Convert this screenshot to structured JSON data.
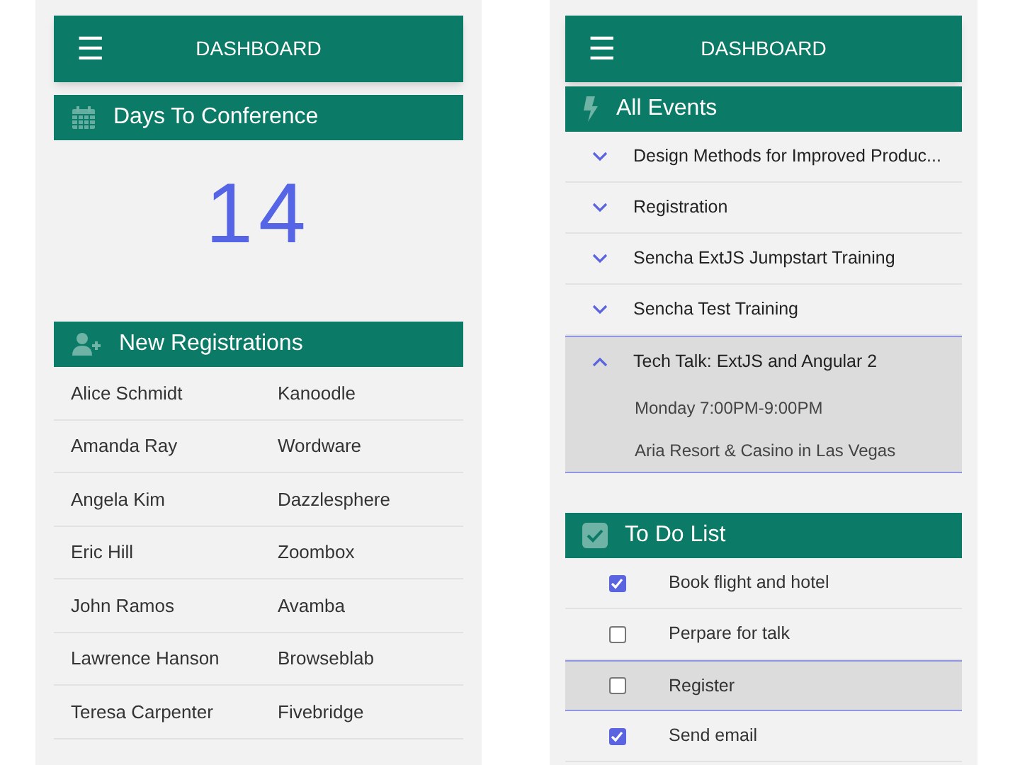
{
  "left": {
    "toolbar": {
      "menu_icon": "☰",
      "title": "DASHBOARD"
    },
    "countdown": {
      "title": "Days To Conference",
      "value": "14"
    },
    "registrations": {
      "title": "New Registrations",
      "rows": [
        {
          "name": "Alice Schmidt",
          "company": "Kanoodle"
        },
        {
          "name": "Amanda Ray",
          "company": "Wordware"
        },
        {
          "name": "Angela Kim",
          "company": "Dazzlesphere"
        },
        {
          "name": "Eric Hill",
          "company": "Zoombox"
        },
        {
          "name": "John Ramos",
          "company": "Avamba"
        },
        {
          "name": "Lawrence Hanson",
          "company": "Browseblab"
        },
        {
          "name": "Teresa Carpenter",
          "company": "Fivebridge"
        }
      ]
    }
  },
  "right": {
    "toolbar": {
      "menu_icon": "☰",
      "title": "DASHBOARD"
    },
    "events": {
      "title": "All Events",
      "items": [
        {
          "title": "Design Methods for Improved Produc...",
          "expanded": false
        },
        {
          "title": "Registration",
          "expanded": false
        },
        {
          "title": "Sencha ExtJS Jumpstart Training",
          "expanded": false
        },
        {
          "title": "Sencha Test Training",
          "expanded": false
        },
        {
          "title": "Tech Talk: ExtJS and Angular 2",
          "expanded": true,
          "details": [
            "Monday 7:00PM-9:00PM",
            "Aria Resort & Casino in Las Vegas"
          ]
        }
      ]
    },
    "todo": {
      "title": "To Do List",
      "items": [
        {
          "label": "Book flight and hotel",
          "checked": true,
          "selected": false
        },
        {
          "label": "Perpare for talk",
          "checked": false,
          "selected": false
        },
        {
          "label": "Register",
          "checked": false,
          "selected": true
        },
        {
          "label": "Send email",
          "checked": true,
          "selected": false
        }
      ]
    }
  }
}
